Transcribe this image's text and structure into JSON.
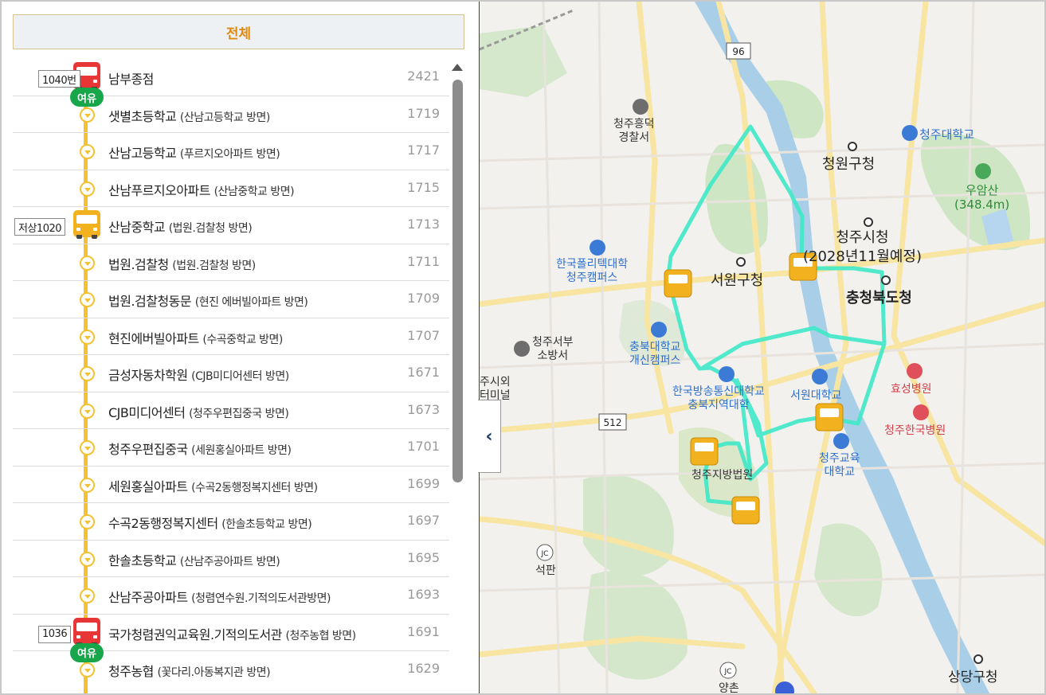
{
  "filter": {
    "label": "전체"
  },
  "stops": [
    {
      "name": "남부종점",
      "dir": "",
      "id": "2421",
      "marker": "bus-red",
      "plate": "1040번",
      "free": "여유"
    },
    {
      "name": "샛별초등학교",
      "dir": "(산남고등학교 방면)",
      "id": "1719",
      "marker": "node"
    },
    {
      "name": "산남고등학교",
      "dir": "(푸르지오아파트 방면)",
      "id": "1717",
      "marker": "node"
    },
    {
      "name": "산남푸르지오아파트",
      "dir": "(산남중학교 방면)",
      "id": "1715",
      "marker": "node"
    },
    {
      "name": "산남중학교",
      "dir": "(법원.검찰청 방면)",
      "id": "1713",
      "marker": "bus-yellow",
      "plate": "저상1020"
    },
    {
      "name": "법원.검찰청",
      "dir": "(법원.검찰청 방면)",
      "id": "1711",
      "marker": "node"
    },
    {
      "name": "법원.검찰청동문",
      "dir": "(현진 에버빌아파트 방면)",
      "id": "1709",
      "marker": "node"
    },
    {
      "name": "현진에버빌아파트",
      "dir": "(수곡중학교 방면)",
      "id": "1707",
      "marker": "node"
    },
    {
      "name": "금성자동차학원",
      "dir": "(CJB미디어센터 방면)",
      "id": "1671",
      "marker": "node"
    },
    {
      "name": "CJB미디어센터",
      "dir": "(청주우편집중국 방면)",
      "id": "1673",
      "marker": "node"
    },
    {
      "name": "청주우편집중국",
      "dir": "(세원홍실아파트 방면)",
      "id": "1701",
      "marker": "node"
    },
    {
      "name": "세원홍실아파트",
      "dir": "(수곡2동행정복지센터 방면)",
      "id": "1699",
      "marker": "node"
    },
    {
      "name": "수곡2동행정복지센터",
      "dir": "(한솔초등학교 방면)",
      "id": "1697",
      "marker": "node"
    },
    {
      "name": "한솔초등학교",
      "dir": "(산남주공아파트 방면)",
      "id": "1695",
      "marker": "node"
    },
    {
      "name": "산남주공아파트",
      "dir": "(청렴연수원.기적의도서관방면)",
      "id": "1693",
      "marker": "node"
    },
    {
      "name": "국가청렴권익교육원.기적의도서관",
      "dir": "(청주농협 방면)",
      "id": "1691",
      "marker": "bus-red",
      "plate": "1036",
      "free": "여유"
    },
    {
      "name": "청주농협",
      "dir": "(꽃다리.아동복지관 방면)",
      "id": "1629",
      "marker": "node"
    }
  ],
  "map": {
    "road_96": "96",
    "road_512": "512",
    "jc1": "JC",
    "jc2": "JC",
    "labels": {
      "police": "청주흥덕\n경찰서",
      "cheongju_univ": "청주대학교",
      "cheongwon_gu": "청원구청",
      "uamsan": "우암산\n(348.4m)",
      "city_hall": "청주시청\n(2028년11월예정)",
      "seowon_gu": "서원구청",
      "provincial": "충청북도청",
      "polytech": "한국폴리텍대학\n청주캠퍼스",
      "fire": "청주서부\n소방서",
      "cbnu": "충북대학교\n개신캠퍼스",
      "knou": "한국방송통신대학교\n충북지역대학",
      "seowon_univ": "서원대학교",
      "hyoseong": "효성병원",
      "hankook": "청주한국병원",
      "edu_univ": "청주교육\n대학교",
      "court": "청주지방법원",
      "seokpan": "석판",
      "terminal": "주시외\n터미널",
      "yangchon": "양촌",
      "sangdang": "상당구청"
    }
  }
}
